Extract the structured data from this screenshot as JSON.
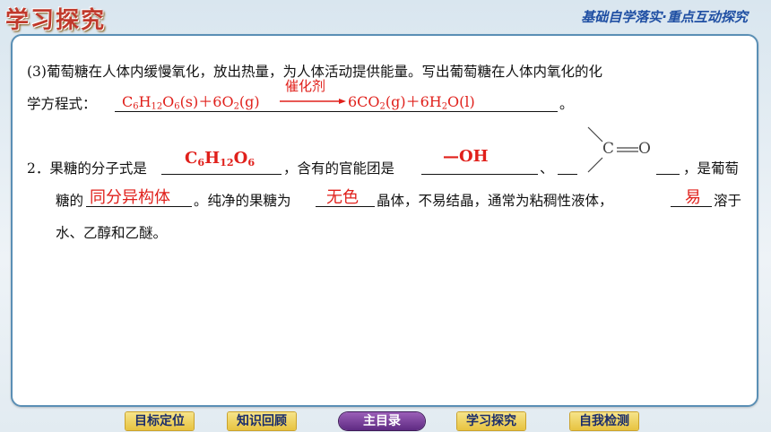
{
  "header": {
    "logo": "学习探究",
    "tagline": "基础自学落实·重点互动探究"
  },
  "q3": {
    "line1": "(3)葡萄糖在人体内缓慢氧化，放出热量，为人体活动提供能量。写出葡萄糖在人体内氧化的化",
    "line2_prefix": "学方程式：",
    "eq_left": "C6H12O6(s)＋6O2(g)",
    "catalyst": "催化剂",
    "eq_right": "6CO2(g)＋6H2O(l)",
    "end": "。"
  },
  "q2": {
    "prefix": "2．果糖的分子式是",
    "formula_answer": "C6H12O6",
    "mid1": "，含有的官能团是",
    "group_answer": "—OH",
    "sep": "、",
    "carbonyl_label": "C",
    "carbonyl_o": "O",
    "mid2": "，是葡萄",
    "line2_a": "糖的",
    "isomer_answer": "同分异构体",
    "line2_b": "。纯净的果糖为",
    "color_answer": "无色",
    "line2_c": "晶体，不易结晶，通常为粘稠性液体，",
    "easy_answer": "易",
    "line2_d": "溶于",
    "line3": "水、乙醇和乙醚。"
  },
  "nav": {
    "items": [
      "目标定位",
      "知识回顾",
      "主目录",
      "学习探究",
      "自我检测"
    ]
  },
  "colors": {
    "answer": "#e0201b",
    "border": "#5a8fb5",
    "nav_gold": "#e7c340",
    "nav_main": "#5e2a82"
  }
}
